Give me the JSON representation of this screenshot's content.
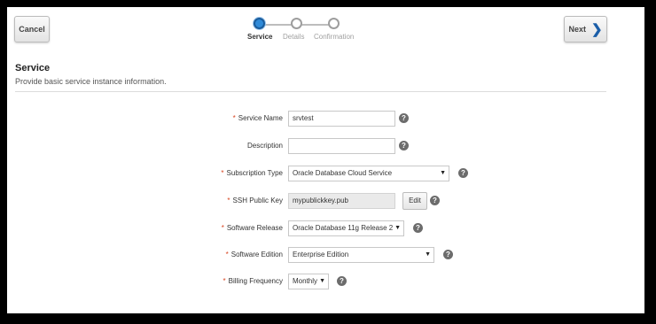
{
  "buttons": {
    "cancel": "Cancel",
    "next": "Next",
    "edit": "Edit"
  },
  "train": {
    "steps": [
      {
        "label": "Service",
        "active": true
      },
      {
        "label": "Details",
        "active": false
      },
      {
        "label": "Confirmation",
        "active": false
      }
    ]
  },
  "section": {
    "title": "Service",
    "subtitle": "Provide basic service instance information."
  },
  "form": {
    "service_name": {
      "label": "Service Name",
      "required": "*",
      "value": "srvtest"
    },
    "description": {
      "label": "Description",
      "value": ""
    },
    "subscription_type": {
      "label": "Subscription Type",
      "required": "*",
      "value": "Oracle Database Cloud Service"
    },
    "ssh_public_key": {
      "label": "SSH Public Key",
      "required": "*",
      "value": "mypublickkey.pub"
    },
    "software_release": {
      "label": "Software Release",
      "required": "*",
      "value": "Oracle Database 11g Release 2"
    },
    "software_edition": {
      "label": "Software Edition",
      "required": "*",
      "value": "Enterprise Edition"
    },
    "billing_frequency": {
      "label": "Billing Frequency",
      "required": "*",
      "value": "Monthly"
    }
  },
  "icons": {
    "help": "?",
    "caret": "▼",
    "chevron": "❯"
  }
}
